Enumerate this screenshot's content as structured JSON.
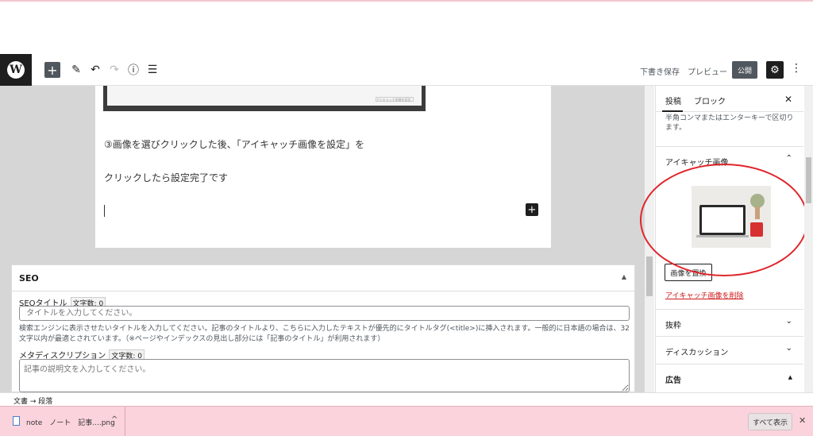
{
  "toolbar": {
    "logo": "W",
    "add_icon": "+",
    "pen_icon": "✎",
    "undo_icon": "↶",
    "redo_icon": "↷",
    "info_icon": "ⓘ",
    "list_icon": "☰",
    "draft_label": "下書き保存",
    "preview_label": "プレビュー",
    "publish_label": "公開",
    "settings_icon": "⚙",
    "more_icon": "⋮"
  },
  "editor": {
    "paragraph1": "③画像を選びクリックした後、「アイキャッチ画像を設定」を",
    "paragraph2": "クリックしたら設定完了です",
    "block_add_icon": "+",
    "screenshot_caption": "アイキャッチ画像を設定"
  },
  "seo": {
    "title": "SEO",
    "toggle_icon": "▲",
    "title_label": "SEOタイトル",
    "title_count": "文字数: 0",
    "title_placeholder": "タイトルを入力してください。",
    "title_help": "検索エンジンに表示させたいタイトルを入力してください。記事のタイトルより、こちらに入力したテキストが優先的にタイトルタグ(<title>)に挿入されます。一般的に日本語の場合は、32文字以内が最適とされています。（※ページやインデックスの見出し部分には「記事のタイトル」が利用されます）",
    "desc_label": "メタディスクリプション",
    "desc_count": "文字数: 0",
    "desc_placeholder": "記事の説明文を入力してください。"
  },
  "sidebar": {
    "tab_post": "投稿",
    "tab_block": "ブロック",
    "close_icon": "✕",
    "tags_note": "半角コンマまたはエンターキーで区切ります。",
    "featured_title": "アイキャッチ画像",
    "featured_chevron": "⌃",
    "replace_label": "画像を置換",
    "remove_label": "アイキャッチ画像を削除",
    "excerpt_title": "抜粋",
    "discussion_title": "ディスカッション",
    "ad_title": "広告",
    "chevron_down": "⌄",
    "ad_toggle": "▲"
  },
  "breadcrumb": "文書 → 段落",
  "downloads": {
    "file_name": "note　ノート　記事....png",
    "caret": "^",
    "show_all": "すべて表示",
    "close_icon": "✕"
  },
  "colors": {
    "toolbar_dark": "#1e1e1e",
    "publish_bg": "#50575e",
    "remove_link": "#cc1818",
    "annotation": "#e0262c",
    "download_bar": "#fbd3dc"
  }
}
